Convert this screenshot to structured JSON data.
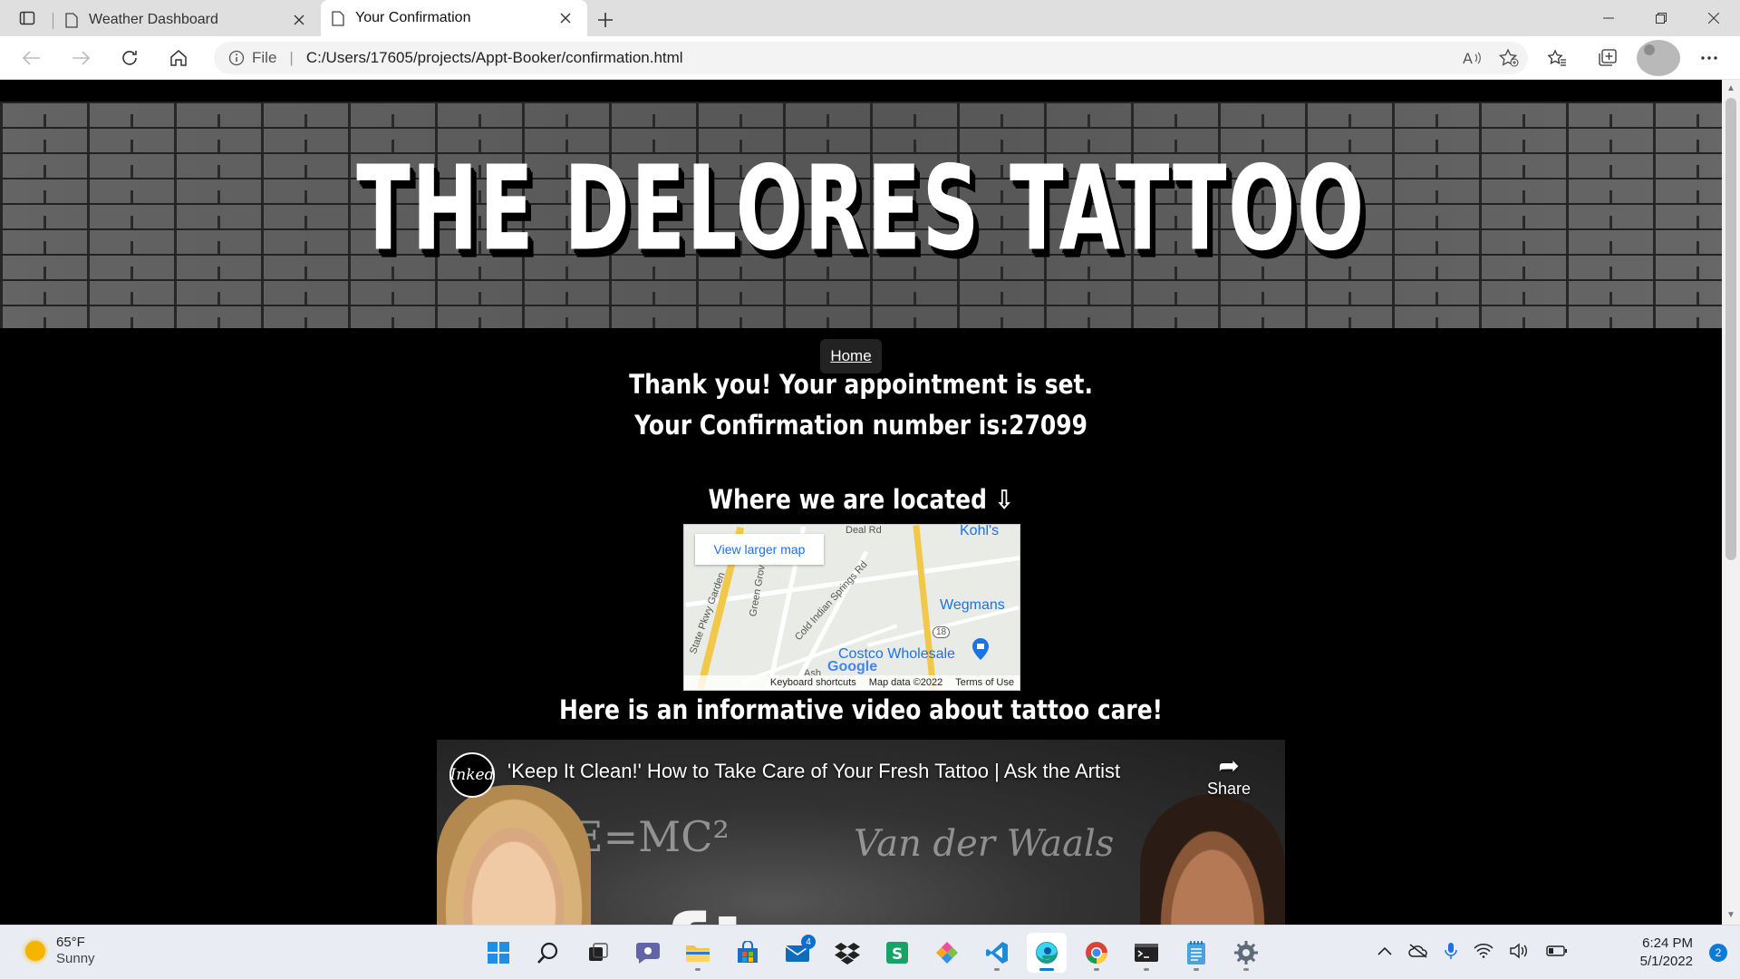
{
  "browser": {
    "tabs": [
      {
        "title": "Weather Dashboard",
        "active": false
      },
      {
        "title": "Your Confirmation",
        "active": true
      }
    ],
    "address": {
      "scheme_label": "File",
      "url": "C:/Users/17605/projects/Appt-Booker/confirmation.html"
    }
  },
  "page": {
    "hero_title": "THE DELORES TATTOO",
    "nav_home": "Home",
    "confirmation_line1": "Thank you! Your appointment is set.",
    "confirmation_line2": "Your Confirmation number is:27099",
    "location_heading": "Where we are located ⇩",
    "map": {
      "view_larger": "View larger map",
      "labels": [
        "Deal Rd",
        "Kohl's",
        "Wegmans",
        "Costco Wholesale",
        "Green Grove Rd",
        "Cold Indian Springs Rd",
        "State Pkwy Garden",
        "18",
        "Ash"
      ],
      "logo": "Google",
      "footer": [
        "Keyboard shortcuts",
        "Map data ©2022",
        "Terms of Use"
      ]
    },
    "video_heading": "Here is an informative video about tattoo care!",
    "video": {
      "channel_logo": "Inked",
      "title": "'Keep It Clean!' How to Take Care of Your Fresh Tattoo | Ask the Artist",
      "share_label": "Share",
      "chalk_text": [
        "E=MC²",
        "Van der Waals",
        "aftercare"
      ]
    }
  },
  "taskbar": {
    "weather_temp": "65°F",
    "weather_cond": "Sunny",
    "mail_badge": "4",
    "time": "6:24 PM",
    "date": "5/1/2022",
    "notifications": "2"
  }
}
